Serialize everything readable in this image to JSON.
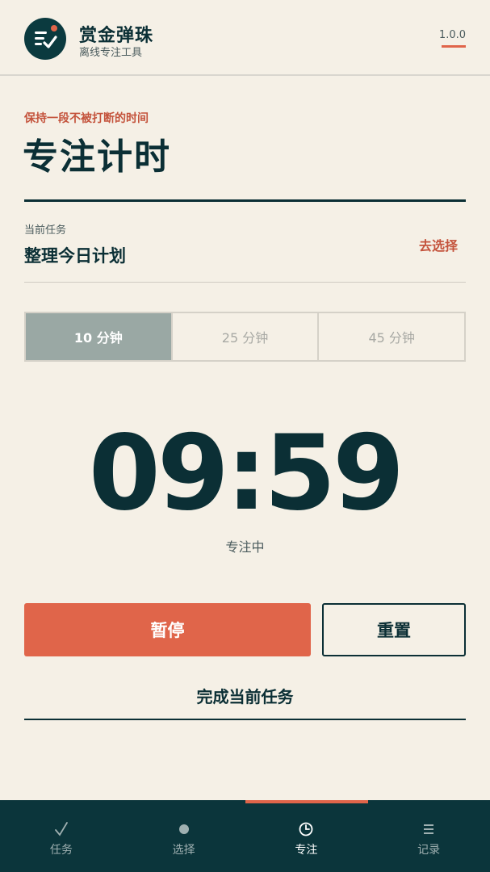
{
  "header": {
    "title": "赏金弹珠",
    "subtitle": "离线专注工具",
    "version": "1.0.0",
    "logo_icon": "list-check-icon"
  },
  "page": {
    "kicker": "保持一段不被打断的时间",
    "title": "专注计时"
  },
  "task": {
    "label": "当前任务",
    "name": "整理今日计划",
    "choose_label": "去选择"
  },
  "durations": {
    "options": [
      "10 分钟",
      "25 分钟",
      "45 分钟"
    ],
    "selected": "10 分钟"
  },
  "timer": {
    "display": "09:59",
    "status": "专注中"
  },
  "actions": {
    "pause_label": "暂停",
    "reset_label": "重置",
    "complete_label": "完成当前任务"
  },
  "nav": {
    "items": [
      {
        "label": "任务",
        "icon": "check-icon"
      },
      {
        "label": "选择",
        "icon": "dot-icon"
      },
      {
        "label": "专注",
        "icon": "clock-icon"
      },
      {
        "label": "记录",
        "icon": "list-icon"
      }
    ],
    "active": "专注"
  },
  "colors": {
    "background": "#f5f0e6",
    "primary": "#0b2f35",
    "accent": "#e0654a",
    "nav_bg": "#0b353b"
  }
}
